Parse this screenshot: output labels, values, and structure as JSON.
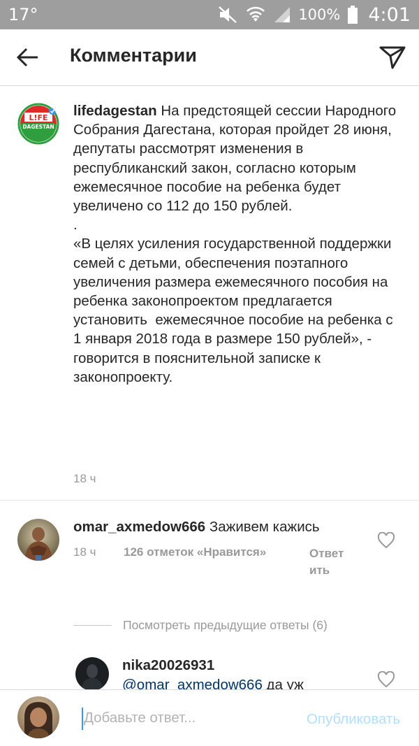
{
  "status_bar": {
    "temperature": "17°",
    "battery_percent": "100%",
    "time": "4:01",
    "icons": [
      "mute-icon",
      "wifi-icon",
      "signal-icon",
      "battery-icon"
    ]
  },
  "header": {
    "title": "Комментарии",
    "back_icon": "arrow-left-icon",
    "send_icon": "send-icon"
  },
  "caption": {
    "username": "lifedagestan",
    "avatar_logo_text": [
      "L!FE",
      "DAGESTAN"
    ],
    "text": " На предстоящей сессии Народного Собрания Дагестана, которая пройдет 28 июня, депутаты рассмотрят изменения в республиканский закон, согласно которым ежемесячное пособие на ребенка будет увеличено со 112 до 150 рублей.\n.\n«В целях усиления государственной поддержки семей с детьми, обеспечения поэтапного увеличения размера ежемесячного пособия на ребенка законопроектом предлагается установить  ежемесячное пособие на ребенка с 1 января 2018 года в размере 150 рублей», - говорится в пояснительной записке к законопроекту.",
    "time": "18 ч"
  },
  "comment": {
    "username": "omar_axmedow666",
    "text": "Заживем кажись",
    "time": "18 ч",
    "likes": "126 отметок «Нравится»",
    "reply_label": "Ответить"
  },
  "view_replies": {
    "label": "Посмотреть предыдущие ответы (6)"
  },
  "reply": {
    "username": "nika20026931",
    "mention": "@omar_axmedow666",
    "text": " да уж"
  },
  "input": {
    "placeholder": "Добавьте ответ...",
    "value": "",
    "publish_label": "Опубликовать"
  },
  "colors": {
    "accent_blue": "#3897f0",
    "publish_disabled": "#b2dffc",
    "mention": "#003569",
    "secondary_text": "#999999",
    "status_bar": "#9e9e9e"
  }
}
